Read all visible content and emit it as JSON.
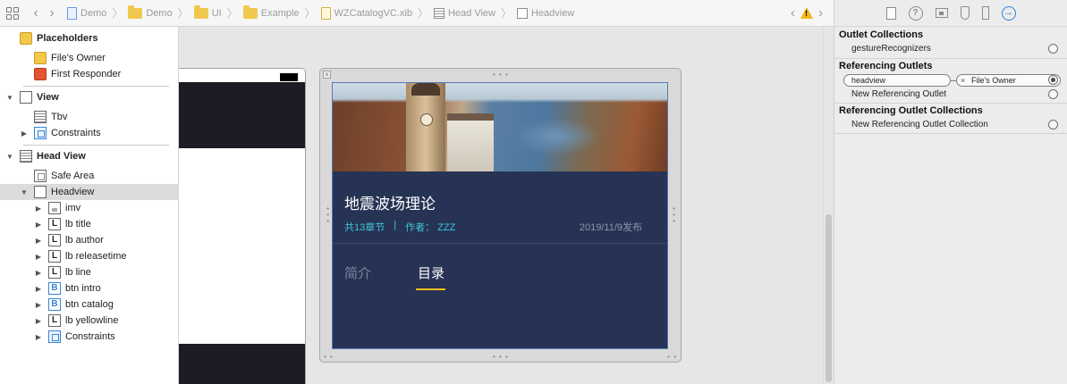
{
  "jumpbar": {
    "crumbs": [
      "Demo",
      "Demo",
      "UI",
      "Example",
      "WZCatalogVC.xib",
      "Head View",
      "Headview"
    ],
    "back_glyph": "‹",
    "forward_glyph": "›",
    "sep": "〉"
  },
  "outline": {
    "placeholders": "Placeholders",
    "files_owner": "File's Owner",
    "first_responder": "First Responder",
    "view": "View",
    "tbv": "Tbv",
    "constraints_1": "Constraints",
    "head_view": "Head View",
    "safe_area": "Safe Area",
    "headview": "Headview",
    "children": [
      "imv",
      "lb title",
      "lb author",
      "lb releasetime",
      "lb line",
      "btn intro",
      "btn catalog",
      "lb yellowline",
      "Constraints"
    ]
  },
  "head": {
    "title": "地震波场理论",
    "chapters": "共13章节",
    "divider": "|",
    "author": "作者： ZZZ",
    "date": "2019/11/9发布",
    "tab_intro": "简介",
    "tab_catalog": "目录"
  },
  "inspector": {
    "outlet_collections": "Outlet Collections",
    "gesture_recognizers": "gestureRecognizers",
    "referencing_outlets": "Referencing Outlets",
    "outlet_name": "headview",
    "outlet_target": "File's Owner",
    "new_referencing_outlet": "New Referencing Outlet",
    "referencing_outlet_collections": "Referencing Outlet Collections",
    "new_referencing_outlet_collection": "New Referencing Outlet Collection"
  },
  "colors": {
    "head_bg": "#263354",
    "accent_cyan": "#3ec7d8",
    "yellow": "#f0c020",
    "selection": "#dcdcdc"
  }
}
